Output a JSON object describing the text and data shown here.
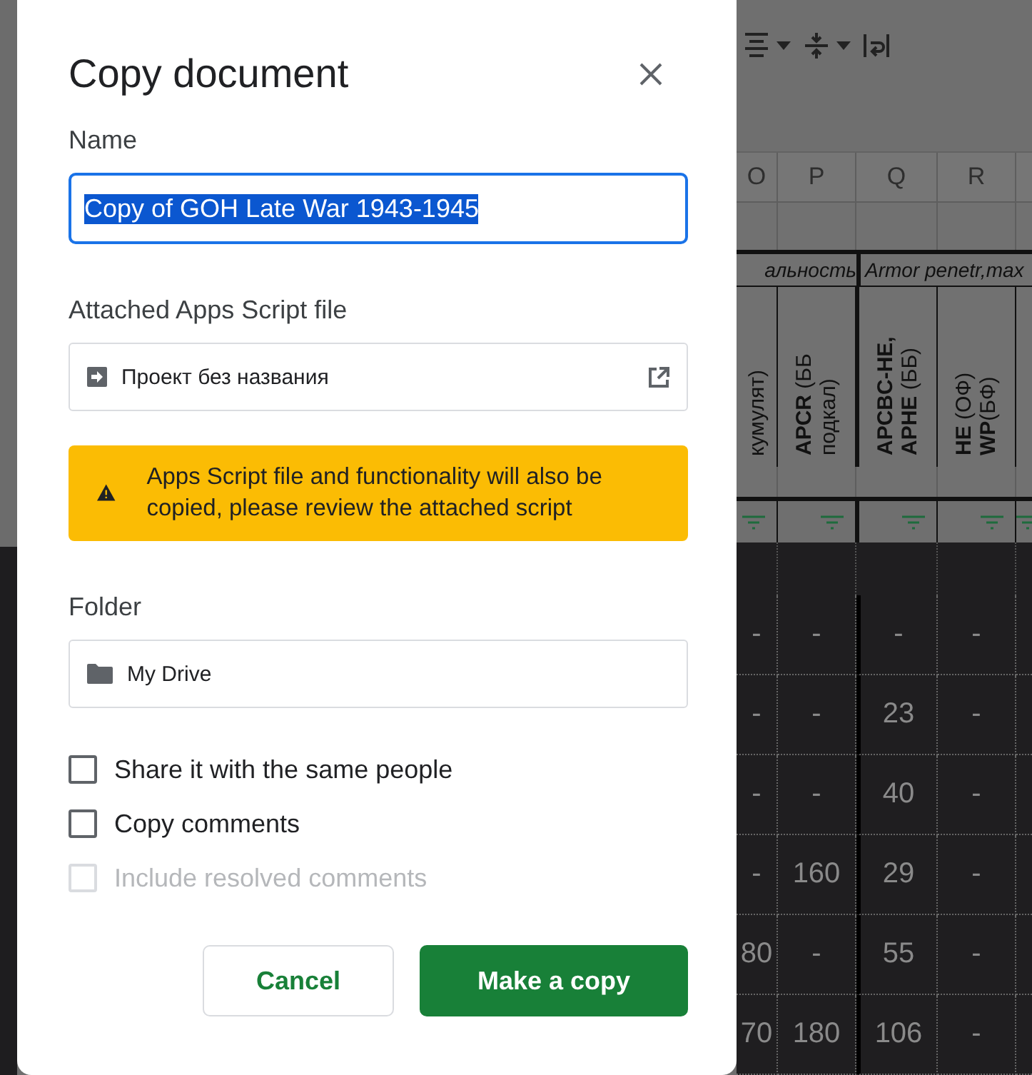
{
  "dialog": {
    "title": "Copy document",
    "name_label": "Name",
    "name_value": "Copy of GOH Late War 1943-1945",
    "name_selected": true,
    "script_label": "Attached Apps Script file",
    "script_file": "Проект без названия",
    "warning": "Apps Script file and functionality will also be copied, please review the attached script",
    "folder_label": "Folder",
    "folder": "My Drive",
    "options": [
      {
        "label": "Share it with the same people",
        "checked": false,
        "disabled": false
      },
      {
        "label": "Copy comments",
        "checked": false,
        "disabled": false
      },
      {
        "label": "Include resolved comments",
        "checked": false,
        "disabled": true
      }
    ],
    "buttons": [
      {
        "label": "Cancel",
        "kind": "secondary"
      },
      {
        "label": "Make a copy",
        "kind": "primary"
      }
    ]
  },
  "spreadsheet": {
    "column_headers": [
      "O",
      "P",
      "Q",
      "R"
    ],
    "group_headers": [
      "альность",
      "Armor penetr,max"
    ],
    "field_headers": [
      "кумулят)",
      "**APCR** (ББ подкал)",
      "**APCBC-HE, APHE** (ББ)",
      "**HE** (ОФ) **WP**(БФ)"
    ],
    "rows": [
      [
        "-",
        "-",
        "-",
        "-"
      ],
      [
        "-",
        "-",
        "23",
        "-"
      ],
      [
        "-",
        "-",
        "40",
        "-"
      ],
      [
        "-",
        "160",
        "29",
        "-"
      ],
      [
        "80",
        "-",
        "55",
        "-"
      ],
      [
        "70",
        "180",
        "106",
        "-"
      ]
    ]
  }
}
